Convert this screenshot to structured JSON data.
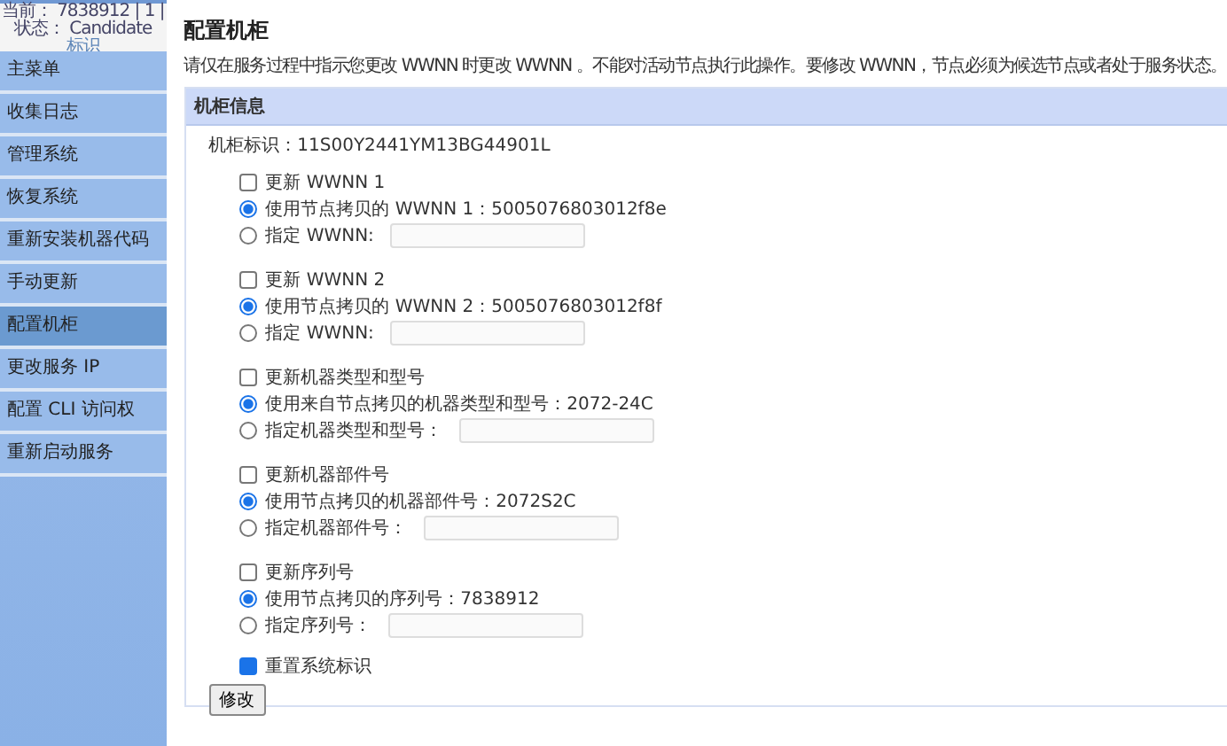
{
  "status": {
    "lines": [
      "当前： 7838912 | 1 |",
      "状态： Candidate",
      "标识"
    ]
  },
  "sidebar": {
    "items": [
      {
        "label": "主菜单",
        "selected": false
      },
      {
        "label": "收集日志",
        "selected": false
      },
      {
        "label": "管理系统",
        "selected": false
      },
      {
        "label": "恢复系统",
        "selected": false
      },
      {
        "label": "重新安装机器代码",
        "selected": false
      },
      {
        "label": "手动更新",
        "selected": false
      },
      {
        "label": "配置机柜",
        "selected": true
      },
      {
        "label": "更改服务 IP",
        "selected": false
      },
      {
        "label": "配置 CLI 访问权",
        "selected": false
      },
      {
        "label": "重新启动服务",
        "selected": false
      }
    ]
  },
  "page": {
    "title": "配置机柜",
    "description": "请仅在服务过程中指示您更改 WWNN 时更改 WWNN 。不能对活动节点执行此操作。要修改 WWNN，节点必须为候选节点或者处于服务状态。"
  },
  "panel": {
    "title": "机柜信息",
    "enclosure_id": "机柜标识：11S00Y2441YM13BG44901L",
    "groups": [
      {
        "label": "更新 WWNN 1",
        "checked": false,
        "options": [
          {
            "kind": "text",
            "label": "使用节点拷贝的 WWNN 1：5005076803012f8e",
            "selected": true
          },
          {
            "kind": "input",
            "label": "指定 WWNN:",
            "selected": false
          }
        ]
      },
      {
        "label": "更新 WWNN 2",
        "checked": false,
        "options": [
          {
            "kind": "text",
            "label": "使用节点拷贝的 WWNN 2：5005076803012f8f",
            "selected": true
          },
          {
            "kind": "input",
            "label": "指定 WWNN:",
            "selected": false
          }
        ]
      },
      {
        "label": "更新机器类型和型号",
        "checked": false,
        "options": [
          {
            "kind": "text",
            "label": "使用来自节点拷贝的机器类型和型号：2072-24C",
            "selected": true
          },
          {
            "kind": "input",
            "label": "指定机器类型和型号：",
            "selected": false
          }
        ]
      },
      {
        "label": "更新机器部件号",
        "checked": false,
        "options": [
          {
            "kind": "text",
            "label": "使用节点拷贝的机器部件号：2072S2C",
            "selected": true
          },
          {
            "kind": "input",
            "label": "指定机器部件号：",
            "selected": false
          }
        ]
      },
      {
        "label": "更新序列号",
        "checked": false,
        "options": [
          {
            "kind": "text",
            "label": "使用节点拷贝的序列号：7838912",
            "selected": true
          },
          {
            "kind": "input",
            "label": "指定序列号：",
            "selected": false
          }
        ]
      }
    ],
    "reset": {
      "label": "重置系统标识",
      "checked": true
    },
    "button": "修改"
  }
}
